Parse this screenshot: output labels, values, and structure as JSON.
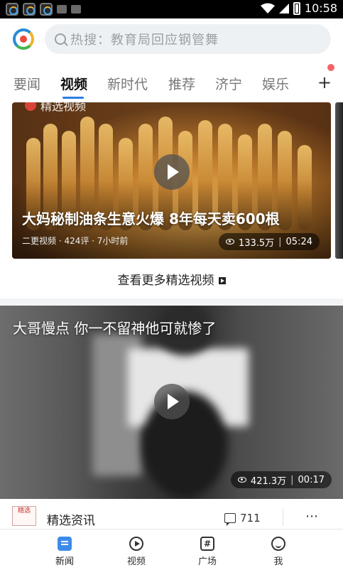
{
  "status_bar": {
    "time": "10:58"
  },
  "header": {
    "logo_icon": "app-logo-icon",
    "search": {
      "placeholder": "热搜：教育局回应钢管舞"
    }
  },
  "tabs": {
    "items": [
      {
        "label": "要闻"
      },
      {
        "label": "视频"
      },
      {
        "label": "新时代"
      },
      {
        "label": "推荐"
      },
      {
        "label": "济宁"
      },
      {
        "label": "娱乐"
      }
    ],
    "active_index": 1,
    "add_label": "+"
  },
  "featured": {
    "section_label": "精选视频",
    "title": "大妈秘制油条生意火爆 8年每天卖600根",
    "meta": "二更视频 · 424评 · 7小时前",
    "views": "133.5万",
    "duration": "05:24",
    "more_label": "查看更多精选视频"
  },
  "video2": {
    "title": "大哥慢点 你一不留神他可就惨了",
    "views": "421.3万",
    "duration": "00:17",
    "source_logo": "精选",
    "source_name": "精选资讯",
    "comments": "711",
    "more_icon": "⋯"
  },
  "bottom_nav": {
    "items": [
      {
        "label": "新闻",
        "icon": "news-icon",
        "active": true
      },
      {
        "label": "视频",
        "icon": "video-icon",
        "active": false
      },
      {
        "label": "广场",
        "icon": "square-icon",
        "active": false
      },
      {
        "label": "我",
        "icon": "me-icon",
        "active": false
      }
    ]
  },
  "colors": {
    "accent": "#2a7de1",
    "red_dot": "#f26464"
  }
}
